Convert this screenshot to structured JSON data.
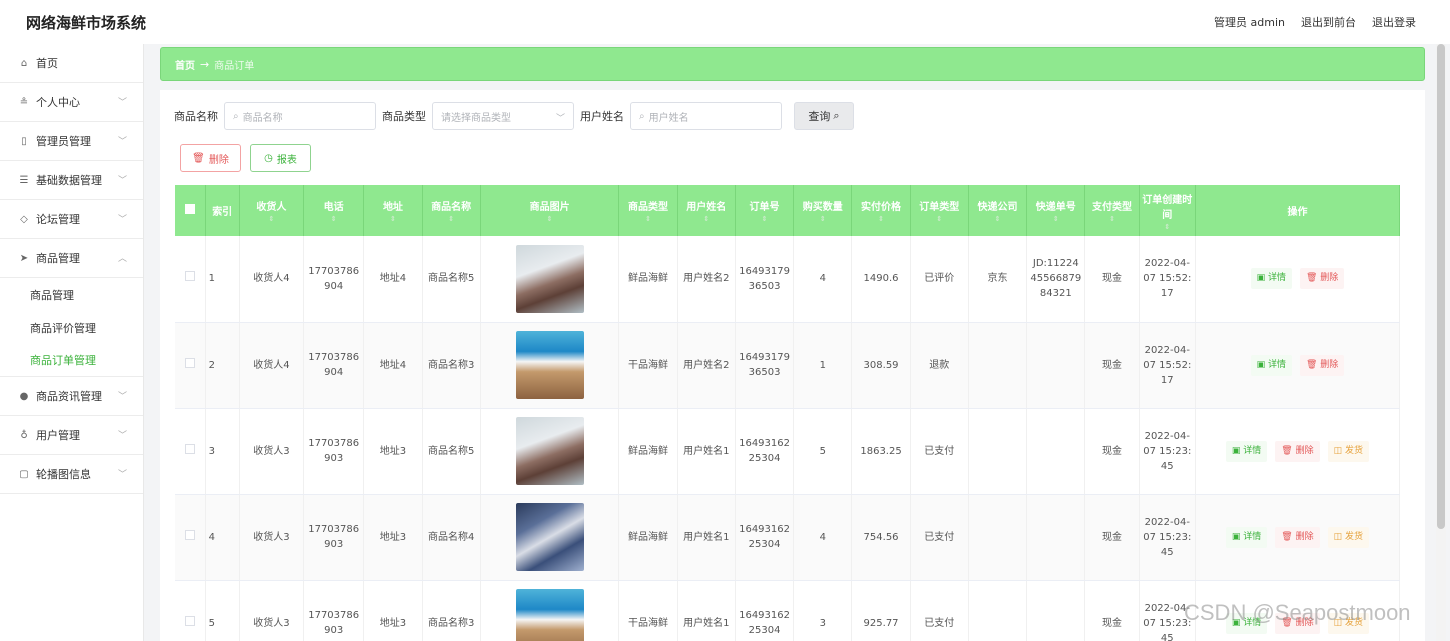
{
  "app": {
    "title": "网络海鲜市场系统"
  },
  "topbar": {
    "admin": "管理员 admin",
    "to_front": "退出到前台",
    "logout": "退出登录"
  },
  "sidebar": {
    "items": [
      {
        "label": "首页",
        "icon": "home-icon"
      },
      {
        "label": "个人中心",
        "icon": "user-icon"
      },
      {
        "label": "管理员管理",
        "icon": "admin-icon"
      },
      {
        "label": "基础数据管理",
        "icon": "list-icon"
      },
      {
        "label": "论坛管理",
        "icon": "forum-icon"
      },
      {
        "label": "商品管理",
        "icon": "send-icon"
      },
      {
        "label": "商品资讯管理",
        "icon": "location-icon"
      },
      {
        "label": "用户管理",
        "icon": "mic-icon"
      },
      {
        "label": "轮播图信息",
        "icon": "carousel-icon"
      }
    ],
    "sub_items": [
      {
        "label": "商品管理"
      },
      {
        "label": "商品评价管理"
      },
      {
        "label": "商品订单管理"
      }
    ]
  },
  "breadcrumb": {
    "home": "首页",
    "arrow": "→",
    "current": "商品订单"
  },
  "search": {
    "name_label": "商品名称",
    "name_placeholder": "商品名称",
    "type_label": "商品类型",
    "type_placeholder": "请选择商品类型",
    "user_label": "用户姓名",
    "user_placeholder": "用户姓名",
    "query_button": "查询"
  },
  "actions": {
    "delete": "删除",
    "report": "报表"
  },
  "table": {
    "headers": [
      "",
      "索引",
      "收货人",
      "电话",
      "地址",
      "商品名称",
      "商品图片",
      "商品类型",
      "用户姓名",
      "订单号",
      "购买数量",
      "实付价格",
      "订单类型",
      "快递公司",
      "快递单号",
      "支付类型",
      "订单创建时间",
      "操作"
    ],
    "op_labels": {
      "detail": "详情",
      "delete": "删除",
      "ship": "发货"
    },
    "rows": [
      {
        "index": "1",
        "receiver": "收货人4",
        "phone": "17703786904",
        "address": "地址4",
        "product": "商品名称5",
        "image": "t5",
        "type": "鲜品海鲜",
        "user": "用户姓名2",
        "order_no": "1649317936503",
        "qty": "4",
        "price": "1490.6",
        "status": "已评价",
        "courier": "京东",
        "tracking": "JD:112244556687984321",
        "pay": "现金",
        "created": "2022-04-07 15:52:17",
        "ship": false
      },
      {
        "index": "2",
        "receiver": "收货人4",
        "phone": "17703786904",
        "address": "地址4",
        "product": "商品名称3",
        "image": "t3",
        "type": "干品海鲜",
        "user": "用户姓名2",
        "order_no": "1649317936503",
        "qty": "1",
        "price": "308.59",
        "status": "退款",
        "courier": "",
        "tracking": "",
        "pay": "现金",
        "created": "2022-04-07 15:52:17",
        "ship": false
      },
      {
        "index": "3",
        "receiver": "收货人3",
        "phone": "17703786903",
        "address": "地址3",
        "product": "商品名称5",
        "image": "t5",
        "type": "鲜品海鲜",
        "user": "用户姓名1",
        "order_no": "1649316225304",
        "qty": "5",
        "price": "1863.25",
        "status": "已支付",
        "courier": "",
        "tracking": "",
        "pay": "现金",
        "created": "2022-04-07 15:23:45",
        "ship": true
      },
      {
        "index": "4",
        "receiver": "收货人3",
        "phone": "17703786903",
        "address": "地址3",
        "product": "商品名称4",
        "image": "t4",
        "type": "鲜品海鲜",
        "user": "用户姓名1",
        "order_no": "1649316225304",
        "qty": "4",
        "price": "754.56",
        "status": "已支付",
        "courier": "",
        "tracking": "",
        "pay": "现金",
        "created": "2022-04-07 15:23:45",
        "ship": true
      },
      {
        "index": "5",
        "receiver": "收货人3",
        "phone": "17703786903",
        "address": "地址3",
        "product": "商品名称3",
        "image": "t3",
        "type": "干品海鲜",
        "user": "用户姓名1",
        "order_no": "1649316225304",
        "qty": "3",
        "price": "925.77",
        "status": "已支付",
        "courier": "",
        "tracking": "",
        "pay": "现金",
        "created": "2022-04-07 15:23:45",
        "ship": true
      }
    ]
  },
  "watermark": "CSDN @Seapostmoon",
  "colors": {
    "accent": "#8fe88f",
    "danger": "#e35757",
    "success": "#3bb23b",
    "warning": "#e6a23c"
  }
}
